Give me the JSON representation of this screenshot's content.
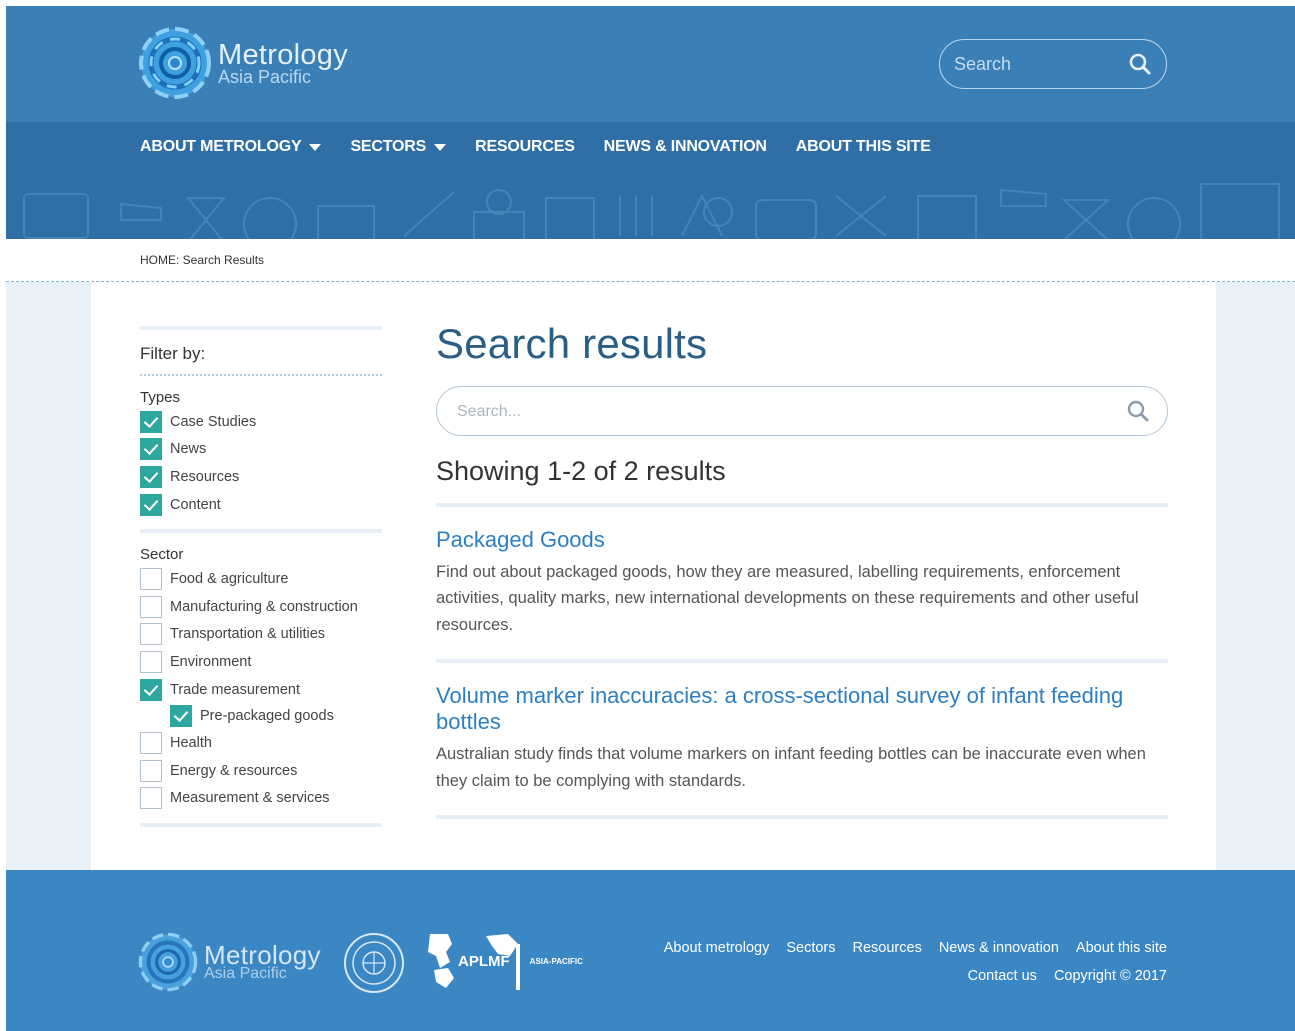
{
  "header": {
    "logo_title": "Metrology",
    "logo_subtitle": "Asia Pacific",
    "search_placeholder": "Search"
  },
  "nav": {
    "items": [
      {
        "label": "ABOUT METROLOGY"
      },
      {
        "label": "SECTORS"
      },
      {
        "label": "RESOURCES"
      },
      {
        "label": "NEWS & INNOVATION"
      },
      {
        "label": "ABOUT THIS SITE"
      }
    ]
  },
  "breadcrumb": "HOME: Search Results",
  "filter": {
    "title": "Filter by:",
    "types_label": "Types",
    "types": [
      {
        "label": "Case Studies",
        "checked": true
      },
      {
        "label": "News",
        "checked": true
      },
      {
        "label": "Resources",
        "checked": true
      },
      {
        "label": "Content",
        "checked": true
      }
    ],
    "sector_label": "Sector",
    "sectors": [
      {
        "label": "Food & agriculture",
        "checked": false
      },
      {
        "label": "Manufacturing & construction",
        "checked": false
      },
      {
        "label": "Transportation & utilities",
        "checked": false
      },
      {
        "label": "Environment",
        "checked": false
      },
      {
        "label": "Trade measurement",
        "checked": true
      },
      {
        "label": "Pre-packaged goods",
        "checked": true
      },
      {
        "label": "Health",
        "checked": false
      },
      {
        "label": "Energy & resources",
        "checked": false
      },
      {
        "label": "Measurement & services",
        "checked": false
      }
    ]
  },
  "results": {
    "title": "Search results",
    "search_placeholder": "Search...",
    "showing": "Showing 1-2 of 2 results",
    "items": [
      {
        "title": "Packaged Goods",
        "description": "Find out about packaged goods, how they are measured, labelling requirements, enforcement activities, quality marks, new international developments on these requirements and other useful resources."
      },
      {
        "title": "Volume marker inaccuracies: a cross-sectional survey of infant feeding bottles",
        "description": "Australian study finds that volume markers on infant feeding bottles can be inaccurate even when they claim to be complying with standards."
      }
    ]
  },
  "footer": {
    "logo_title": "Metrology",
    "logo_subtitle": "Asia Pacific",
    "aplmf_label": "APLMF",
    "aplmf_sub": "ASIA-PACIFIC",
    "links": [
      {
        "label": "About metrology"
      },
      {
        "label": "Sectors"
      },
      {
        "label": "Resources"
      },
      {
        "label": "News & innovation"
      },
      {
        "label": "About this site"
      }
    ],
    "contact": "Contact us",
    "copyright": "Copyright © 2017"
  },
  "colors": {
    "header_blue": "#3a7fb6",
    "nav_blue": "#2f6fa6",
    "footer_blue": "#3b87c4",
    "heading_blue": "#2b5e85",
    "link_blue": "#2d7fc1",
    "checkbox_teal": "#2da7a0",
    "side_panel": "#e8f1f8"
  },
  "icons": [
    "logo-icon",
    "search-icon",
    "caret-down-icon",
    "checkmark-icon",
    "seal-icon",
    "aplmf-map-icon"
  ]
}
